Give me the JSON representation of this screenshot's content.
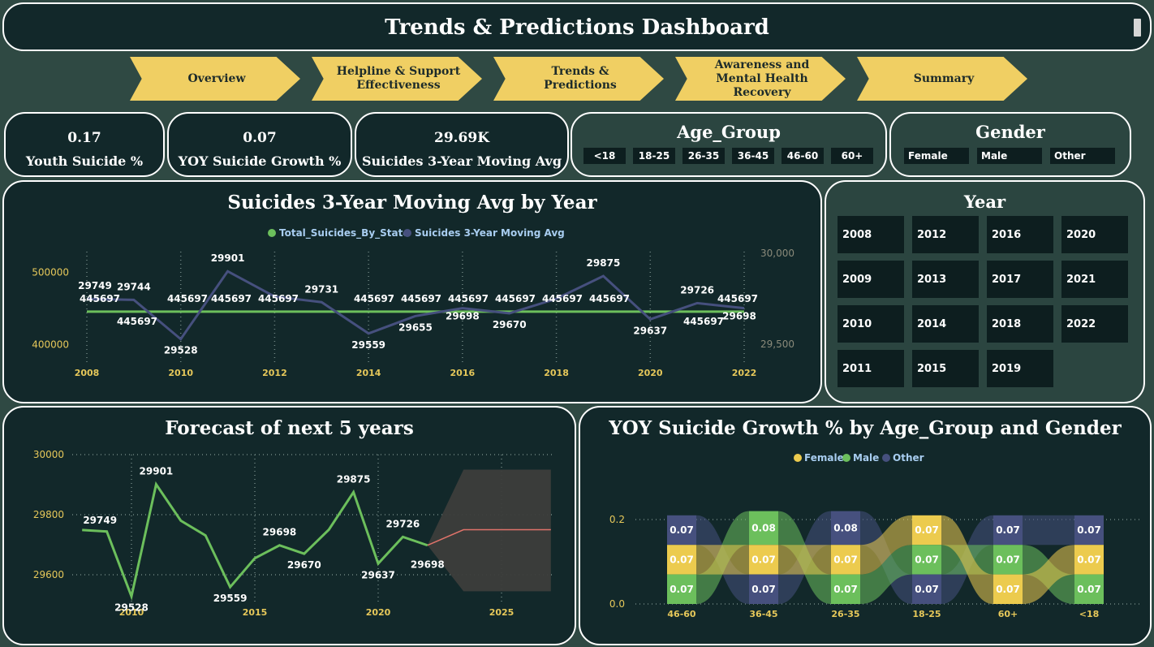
{
  "header": {
    "title": "Trends & Predictions Dashboard"
  },
  "nav": [
    {
      "label": "Overview"
    },
    {
      "label": "Helpline & Support Effectiveness"
    },
    {
      "label": "Trends & Predictions"
    },
    {
      "label": "Awareness and Mental Health Recovery"
    },
    {
      "label": "Summary"
    }
  ],
  "kpis": [
    {
      "value": "0.17",
      "label": "Youth Suicide %"
    },
    {
      "value": "0.07",
      "label": "YOY Suicide Growth %"
    },
    {
      "value": "29.69K",
      "label": "Suicides 3-Year Moving Avg"
    }
  ],
  "age_group_slicer": {
    "title": "Age_Group",
    "options": [
      "<18",
      "18-25",
      "26-35",
      "36-45",
      "46-60",
      "60+"
    ]
  },
  "gender_slicer": {
    "title": "Gender",
    "options": [
      "Female",
      "Male",
      "Other"
    ]
  },
  "year_slicer": {
    "title": "Year",
    "years": [
      "2008",
      "2012",
      "2016",
      "2020",
      "2009",
      "2013",
      "2017",
      "2021",
      "2010",
      "2014",
      "2018",
      "2022",
      "2011",
      "2015",
      "2019"
    ]
  },
  "colors": {
    "green": "#6cbf5c",
    "navy": "#46507e",
    "yellow": "#eccb4e",
    "axis_yellow": "#e6c85a",
    "legend_blue": "#a8cdf0",
    "panel": "#12282a",
    "forecast_band": "#3d3d3b",
    "forecast_line": "#e0736a"
  },
  "chart_data": [
    {
      "type": "line",
      "title": "Suicides 3-Year Moving Avg by Year",
      "legend": [
        "Total_Suicides_By_State",
        "Suicides 3-Year Moving Avg"
      ],
      "legend_position": "top-center",
      "x": [
        2008,
        2009,
        2010,
        2011,
        2012,
        2013,
        2014,
        2015,
        2016,
        2017,
        2018,
        2019,
        2020,
        2021,
        2022
      ],
      "x_ticks": [
        "2008",
        "2010",
        "2012",
        "2014",
        "2016",
        "2018",
        "2020",
        "2022"
      ],
      "series": [
        {
          "name": "Total_Suicides_By_State",
          "axis": "left",
          "values": [
            445697,
            445697,
            445697,
            445697,
            445697,
            445697,
            445697,
            445697,
            445697,
            445697,
            445697,
            445697,
            445697,
            445697,
            445697
          ]
        },
        {
          "name": "Suicides 3-Year Moving Avg",
          "axis": "right",
          "values": [
            29749,
            29744,
            29528,
            29901,
            29762,
            29731,
            29559,
            29655,
            29698,
            29670,
            29750,
            29875,
            29637,
            29726,
            29698
          ],
          "labels": [
            "29749",
            "29744",
            "29528",
            "29901",
            "",
            "29731",
            "29559",
            "29655",
            "29698",
            "29670",
            "",
            "29875",
            "29637",
            "29726",
            "29698"
          ]
        }
      ],
      "left_axis": {
        "ylim": [
          350000,
          550000
        ],
        "ticks": [
          "500000",
          "400000"
        ]
      },
      "right_axis": {
        "ylim": [
          29420,
          30040
        ],
        "ticks": [
          "30,000",
          "29,500"
        ]
      },
      "total_labels": [
        "445697",
        "445697",
        "445697",
        "445697",
        "445697",
        "445697",
        "445697",
        "445697",
        "445697",
        "445697",
        "445697",
        "445697",
        "445697",
        "445697"
      ],
      "grid": "vertical dotted"
    },
    {
      "type": "line",
      "title": "Forecast of next 5 years",
      "x": [
        2008,
        2009,
        2010,
        2011,
        2012,
        2013,
        2014,
        2015,
        2016,
        2017,
        2018,
        2019,
        2020,
        2021,
        2022
      ],
      "x_ticks": [
        "2010",
        "2015",
        "2020",
        "2025"
      ],
      "values": [
        29749,
        29744,
        29528,
        29901,
        29780,
        29731,
        29559,
        29655,
        29698,
        29670,
        29750,
        29875,
        29637,
        29726,
        29698
      ],
      "labels": [
        "29749",
        "",
        "29528",
        "29901",
        "",
        "",
        "29559",
        "",
        "29698",
        "29670",
        "",
        "29875",
        "29637",
        "29726",
        "29698"
      ],
      "forecast": {
        "x": [
          2022,
          2023,
          2027
        ],
        "values": [
          29698,
          29750,
          29750
        ],
        "upper": [
          29698,
          29950,
          29950
        ],
        "lower": [
          29698,
          29545,
          29545
        ]
      },
      "ylim": [
        29520,
        30010
      ],
      "y_ticks": [
        "30000",
        "29800",
        "29600"
      ],
      "grid": "dotted"
    },
    {
      "type": "bar",
      "subtype": "stacked ribbon",
      "title": "YOY Suicide Growth % by Age_Group and Gender",
      "legend": [
        "Female",
        "Male",
        "Other"
      ],
      "legend_position": "top-center",
      "categories": [
        "46-60",
        "36-45",
        "26-35",
        "18-25",
        "60+",
        "<18"
      ],
      "stacks": [
        [
          {
            "series": "Other",
            "value": 0.07,
            "label": "0.07"
          },
          {
            "series": "Female",
            "value": 0.07,
            "label": "0.07"
          },
          {
            "series": "Male",
            "value": 0.07,
            "label": "0.07"
          }
        ],
        [
          {
            "series": "Male",
            "value": 0.08,
            "label": "0.08"
          },
          {
            "series": "Female",
            "value": 0.07,
            "label": "0.07"
          },
          {
            "series": "Other",
            "value": 0.07,
            "label": "0.07"
          }
        ],
        [
          {
            "series": "Other",
            "value": 0.08,
            "label": "0.08"
          },
          {
            "series": "Female",
            "value": 0.07,
            "label": "0.07"
          },
          {
            "series": "Male",
            "value": 0.07,
            "label": "0.07"
          }
        ],
        [
          {
            "series": "Female",
            "value": 0.07,
            "label": "0.07"
          },
          {
            "series": "Male",
            "value": 0.07,
            "label": "0.07"
          },
          {
            "series": "Other",
            "value": 0.07,
            "label": "0.07"
          }
        ],
        [
          {
            "series": "Other",
            "value": 0.07,
            "label": "0.07"
          },
          {
            "series": "Male",
            "value": 0.07,
            "label": "0.07"
          },
          {
            "series": "Female",
            "value": 0.07,
            "label": "0.07"
          }
        ],
        [
          {
            "series": "Other",
            "value": 0.07,
            "label": "0.07"
          },
          {
            "series": "Female",
            "value": 0.07,
            "label": "0.07"
          },
          {
            "series": "Male",
            "value": 0.07,
            "label": "0.07"
          }
        ]
      ],
      "ylim": [
        0,
        0.22
      ],
      "y_ticks": [
        "0.2",
        "0.0"
      ]
    }
  ]
}
